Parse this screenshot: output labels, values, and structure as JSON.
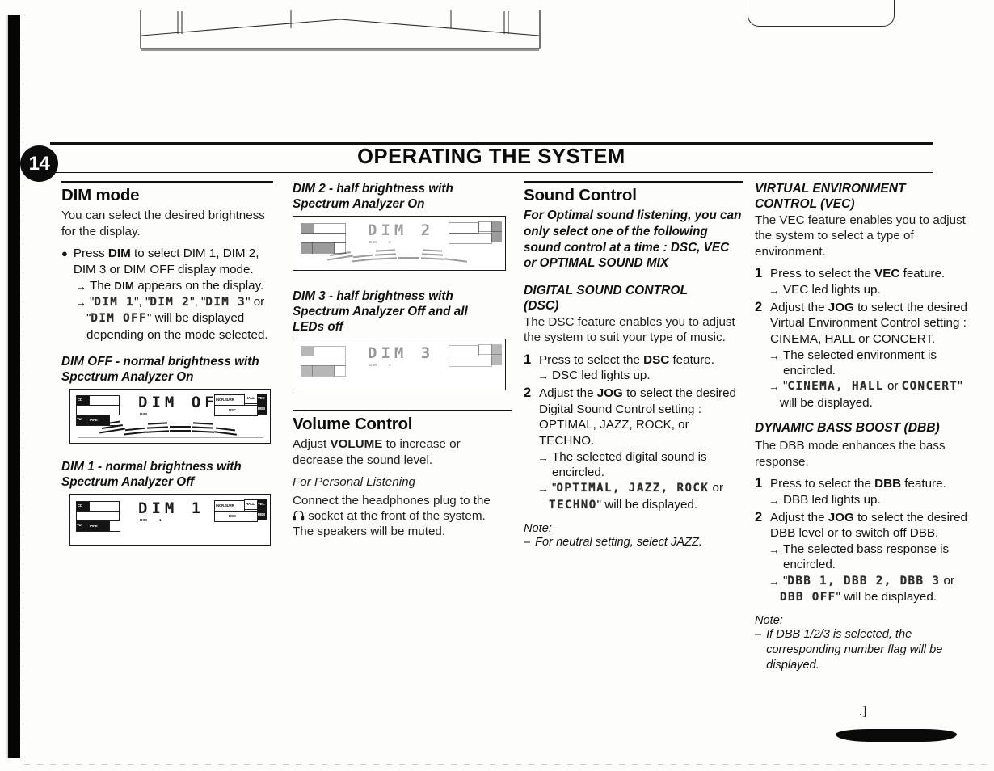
{
  "page": {
    "number": "14",
    "title": "OPERATING THE SYSTEM",
    "stray_mark": ".]"
  },
  "col1": {
    "heading": "DIM mode",
    "intro": "You can select the desired brightness for the display.",
    "bullet": {
      "marker": "●",
      "text_pre": "Press ",
      "bold": "DIM",
      "text_post": " to select DIM 1, DIM 2, DIM 3 or DIM OFF display mode."
    },
    "arrow1": {
      "glyph": "→",
      "pre": "The ",
      "smallcaps": "DIM",
      "post": " appears on the display."
    },
    "arrow2": {
      "glyph": "→",
      "lcd1": "DIM 1",
      "sep1": ", ",
      "lcd2": "DIM 2",
      "sep2": ", ",
      "lcd3": "DIM 3",
      "tail": " or"
    },
    "arrow2_line2_lcd": "DIM OFF",
    "arrow2_line2_tail": " will be displayed",
    "arrow2_line3": "depending on the mode selected.",
    "fig_dimoff_caption_l1": "DIM OFF - normal brightness with",
    "fig_dimoff_caption_l2": "Spcctrum Analyzer On",
    "fig_dimoff_lcd": "DIM OFF",
    "fig_dim1_caption_l1": "DIM 1 - normal brightness with",
    "fig_dim1_caption_l2": "Spectrum Analyzer Off",
    "fig_dim1_lcd": "DIM 1"
  },
  "col2": {
    "fig_dim2_caption_l1": "DIM 2 - half brightness with",
    "fig_dim2_caption_l2": "Spectrum Analyzer On",
    "fig_dim2_lcd": "DIM 2",
    "fig_dim3_caption_l1": "DIM 3 - half brightness with",
    "fig_dim3_caption_l2": "Spectrum Analyzer Off  and all",
    "fig_dim3_caption_l3": "LEDs off",
    "fig_dim3_lcd": "DIM 3",
    "heading": "Volume Control",
    "adjust_pre": "Adjust ",
    "adjust_bold": "VOLUME",
    "adjust_post": " to increase or decrease the sound level.",
    "personal_head": "For Personal Listening",
    "personal_l1": "Connect the headphones plug to the",
    "personal_icon": "headphones-icon",
    "personal_l2": " socket at the front of the system.",
    "personal_l3": "The speakers will be muted."
  },
  "col3": {
    "heading": "Sound Control",
    "lead": "For Optimal sound listening, you can only select one of the following sound control at a time : DSC, VEC or OPTIMAL SOUND MIX",
    "dsc_head_l1": "DIGITAL SOUND CONTROL",
    "dsc_head_l2": "(DSC)",
    "dsc_intro": "The DSC feature enables you to adjust the system to suit your type of music.",
    "step1_num": "1",
    "step1_pre": "Press to select the ",
    "step1_bold": "DSC",
    "step1_post": " feature.",
    "step1_arrow": "DSC led lights up.",
    "step2_num": "2",
    "step2_pre": "Adjust the ",
    "step2_bold": "JOG",
    "step2_post": " to select the desired Digital Sound Control setting : OPTIMAL, JAZZ, ROCK, or TECHNO.",
    "step2_arrow1": "The selected digital sound is encircled.",
    "step2_arrow2_lcd": "OPTIMAL, JAZZ, ROCK",
    "step2_arrow2_mid": " or",
    "step2_arrow2_lcd2": "TECHNO",
    "step2_arrow2_tail": "\" will be displayed.",
    "note_head": "Note:",
    "note_dash": "–",
    "note_text": "For neutral setting, select JAZZ."
  },
  "col4": {
    "vec_head_l1": "VIRTUAL ENVIRONMENT",
    "vec_head_l2": "CONTROL (VEC)",
    "vec_intro": "The VEC feature enables you to adjust the system to select a type of environment.",
    "vec_step1_num": "1",
    "vec_step1_pre": "Press to select the ",
    "vec_step1_bold": "VEC",
    "vec_step1_post": " feature.",
    "vec_step1_arrow": "VEC led lights up.",
    "vec_step2_num": "2",
    "vec_step2_pre": "Adjust the ",
    "vec_step2_bold": "JOG",
    "vec_step2_post": " to select the desired Virtual Environment Control setting : CINEMA, HALL or CONCERT.",
    "vec_step2_arrow1": "The selected environment is encircled.",
    "vec_step2_arrow2_lcd": "CINEMA, HALL",
    "vec_step2_arrow2_mid": " or ",
    "vec_step2_arrow2_lcd2": "CONCERT",
    "vec_step2_arrow2_tail": "\"",
    "vec_step2_arrow2_l2": "will be displayed.",
    "dbb_head": "DYNAMIC BASS BOOST (DBB)",
    "dbb_intro": "The DBB mode enhances the bass response.",
    "dbb_step1_num": "1",
    "dbb_step1_pre": "Press to select the ",
    "dbb_step1_bold": "DBB",
    "dbb_step1_post": " feature.",
    "dbb_step1_arrow": "DBB led lights up.",
    "dbb_step2_num": "2",
    "dbb_step2_pre": "Adjust the ",
    "dbb_step2_bold": "JOG",
    "dbb_step2_post": " to select the desired DBB level or to switch off DBB.",
    "dbb_step2_arrow1": "The selected bass response is encircled.",
    "dbb_step2_arrow2_lcd": "DBB 1, DBB 2, DBB 3",
    "dbb_step2_arrow2_mid": " or",
    "dbb_step2_arrow2_lcd2": "DBB OFF",
    "dbb_step2_arrow2_tail": "\" will be displayed.",
    "note_head": "Note:",
    "note_dash": "–",
    "note_text": "If DBB 1/2/3 is selected, the corresponding number flag will be displayed."
  },
  "display_labels": {
    "cd": "CD",
    "tuner": "TUNER",
    "tape": "TAPE",
    "incr_surr": "INCR.SURR",
    "hall": "HALL",
    "vec": "VEC",
    "dsc": "DSC",
    "dbb": "DBB"
  }
}
